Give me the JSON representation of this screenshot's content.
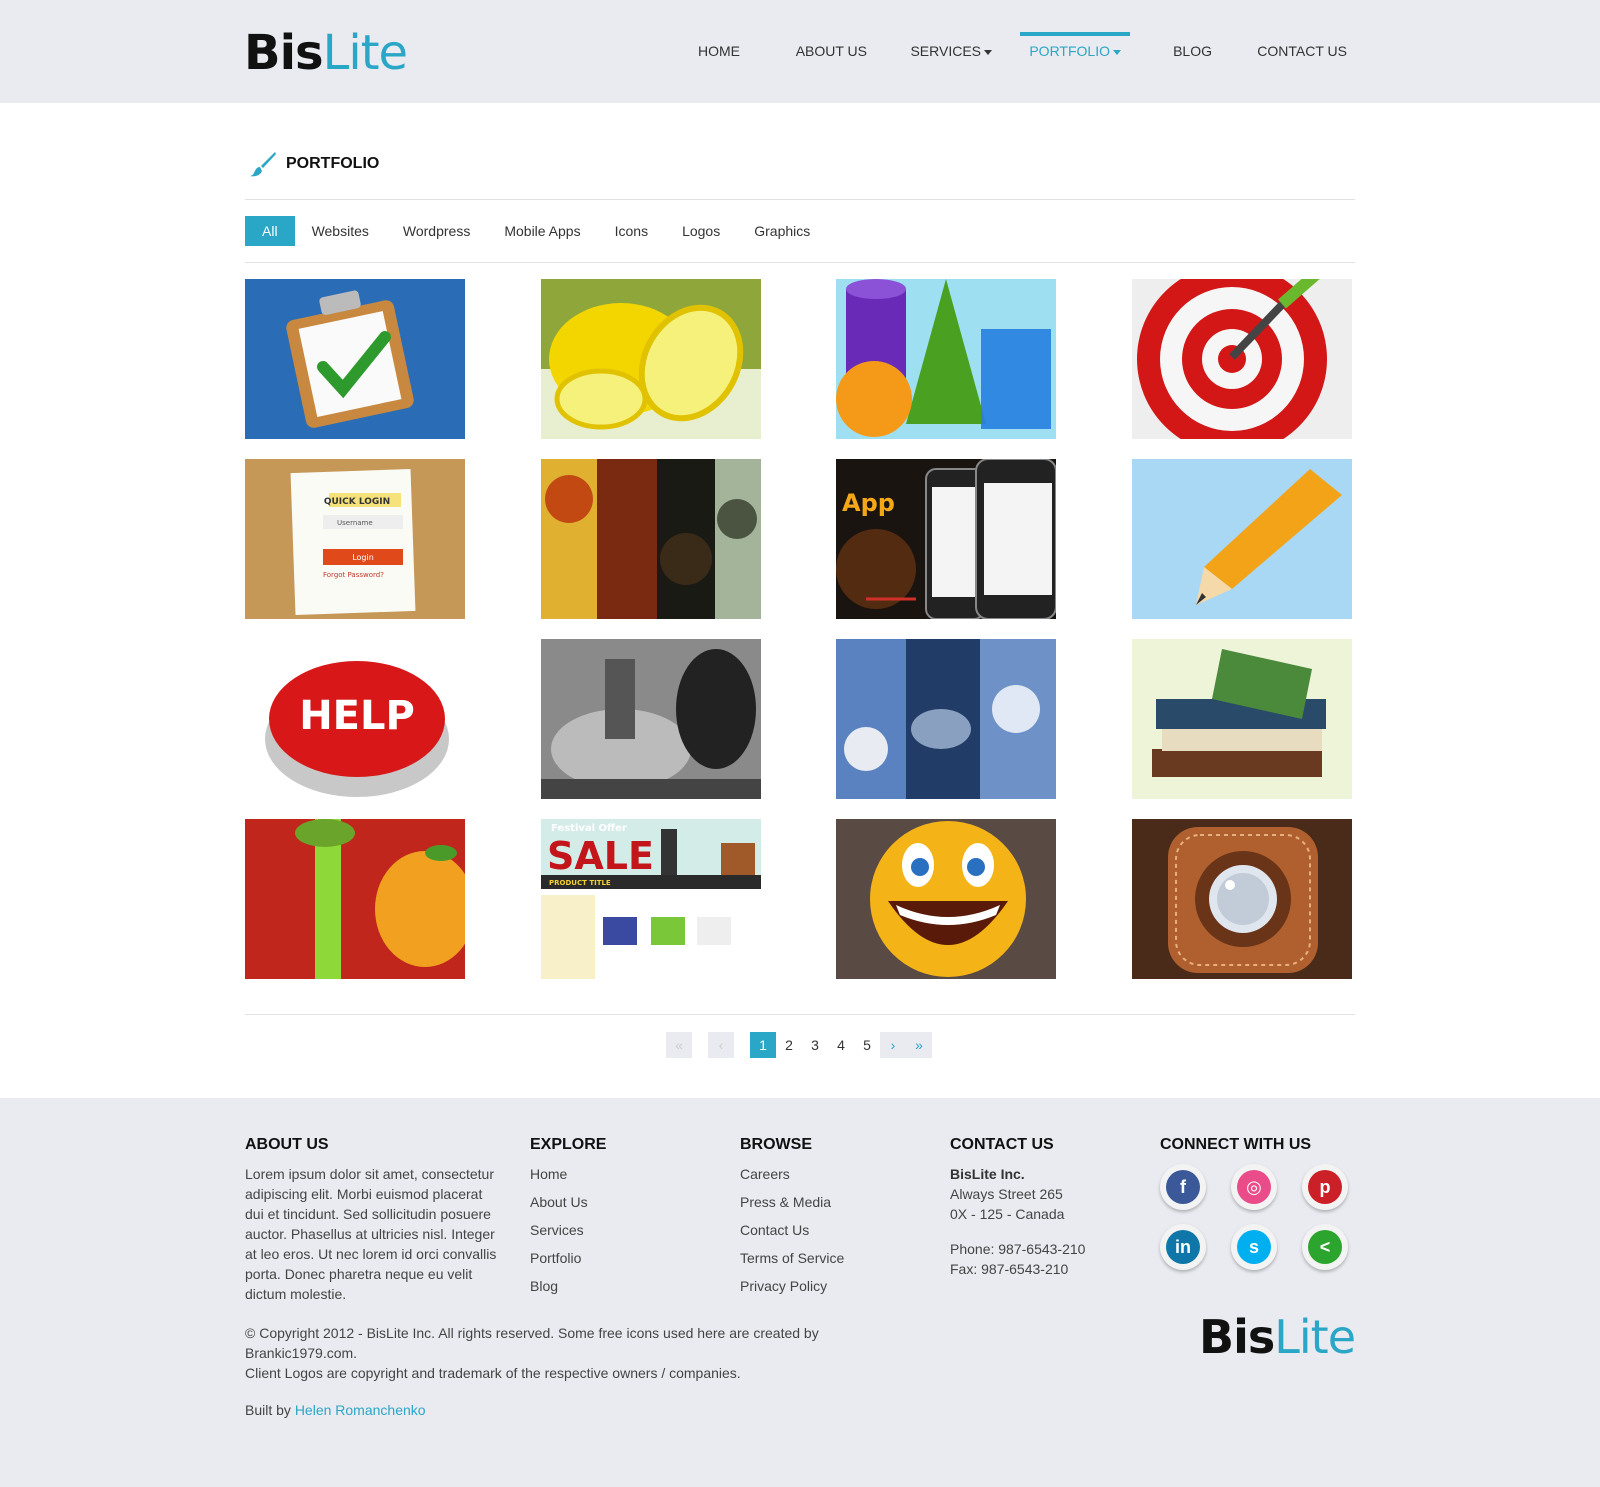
{
  "brand": {
    "part1": "Bis",
    "part2": "Lite"
  },
  "nav": {
    "home": "HOME",
    "about": "ABOUT US",
    "services": "SERVICES",
    "portfolio": "PORTFOLIO",
    "blog": "BLOG",
    "contact": "CONTACT US"
  },
  "page": {
    "title": "PORTFOLIO"
  },
  "filters": [
    "All",
    "Websites",
    "Wordpress",
    "Mobile Apps",
    "Icons",
    "Logos",
    "Graphics"
  ],
  "portfolio_items": [
    {
      "subject": "clipboard-checkmark"
    },
    {
      "subject": "lemons"
    },
    {
      "subject": "3d-shapes"
    },
    {
      "subject": "target-dart"
    },
    {
      "subject": "quick-login-form",
      "text": {
        "title": "QUICK LOGIN",
        "user": "Username",
        "button": "Login",
        "forgot": "Forgot Password?"
      }
    },
    {
      "subject": "texture-strips"
    },
    {
      "subject": "app-phones",
      "text": {
        "title": "App"
      }
    },
    {
      "subject": "pencil"
    },
    {
      "subject": "help-button",
      "text": {
        "title": "HELP"
      }
    },
    {
      "subject": "bw-mechanical"
    },
    {
      "subject": "sky-strips"
    },
    {
      "subject": "books"
    },
    {
      "subject": "gift-apple"
    },
    {
      "subject": "sale-website",
      "text": {
        "title": "SALE",
        "sub": "Festival Offer",
        "bar": "PRODUCT TITLE"
      }
    },
    {
      "subject": "smiley"
    },
    {
      "subject": "leather-knob"
    }
  ],
  "pagination": {
    "first": "«",
    "prev": "‹",
    "pages": [
      "1",
      "2",
      "3",
      "4",
      "5"
    ],
    "next": "›",
    "last": "»",
    "current": "1"
  },
  "footer": {
    "about": {
      "heading": "ABOUT US",
      "text": "Lorem ipsum dolor sit amet, consectetur adipiscing elit. Morbi euismod placerat dui et tincidunt. Sed sollicitudin posuere auctor. Phasellus at ultricies nisl. Integer at leo eros. Ut nec lorem id orci convallis porta. Donec pharetra neque eu velit dictum molestie."
    },
    "explore": {
      "heading": "EXPLORE",
      "links": [
        "Home",
        "About Us",
        "Services",
        "Portfolio",
        "Blog"
      ]
    },
    "browse": {
      "heading": "BROWSE",
      "links": [
        "Careers",
        "Press & Media",
        "Contact Us",
        "Terms of Service",
        "Privacy Policy"
      ]
    },
    "contact": {
      "heading": "CONTACT US",
      "company": "BisLite Inc.",
      "street": "Always Street 265",
      "city": "0X - 125 - Canada",
      "phone": "Phone: 987-6543-210",
      "fax": "Fax: 987-6543-210"
    },
    "connect": {
      "heading": "CONNECT WITH US",
      "networks": [
        {
          "name": "facebook",
          "glyph": "f",
          "color": "#3b5998"
        },
        {
          "name": "dribbble",
          "glyph": "◎",
          "color": "#ea4c89"
        },
        {
          "name": "pinterest",
          "glyph": "p",
          "color": "#cb2027"
        },
        {
          "name": "linkedin",
          "glyph": "in",
          "color": "#0e76a8"
        },
        {
          "name": "skype",
          "glyph": "s",
          "color": "#00aff0"
        },
        {
          "name": "share",
          "glyph": "<",
          "color": "#2ba52e"
        }
      ]
    },
    "copyright1": "© Copyright 2012 - BisLite Inc. All rights reserved. Some free icons used here are created by Brankic1979.com.",
    "copyright2": "Client Logos are copyright and trademark of the respective owners / companies.",
    "built_by_label": "Built by",
    "built_by_name": "Helen Romanchenko"
  },
  "colors": {
    "accent": "#2aa6c6",
    "header_bg": "#e9ebf1",
    "footer_bg": "#e9ebf1"
  }
}
